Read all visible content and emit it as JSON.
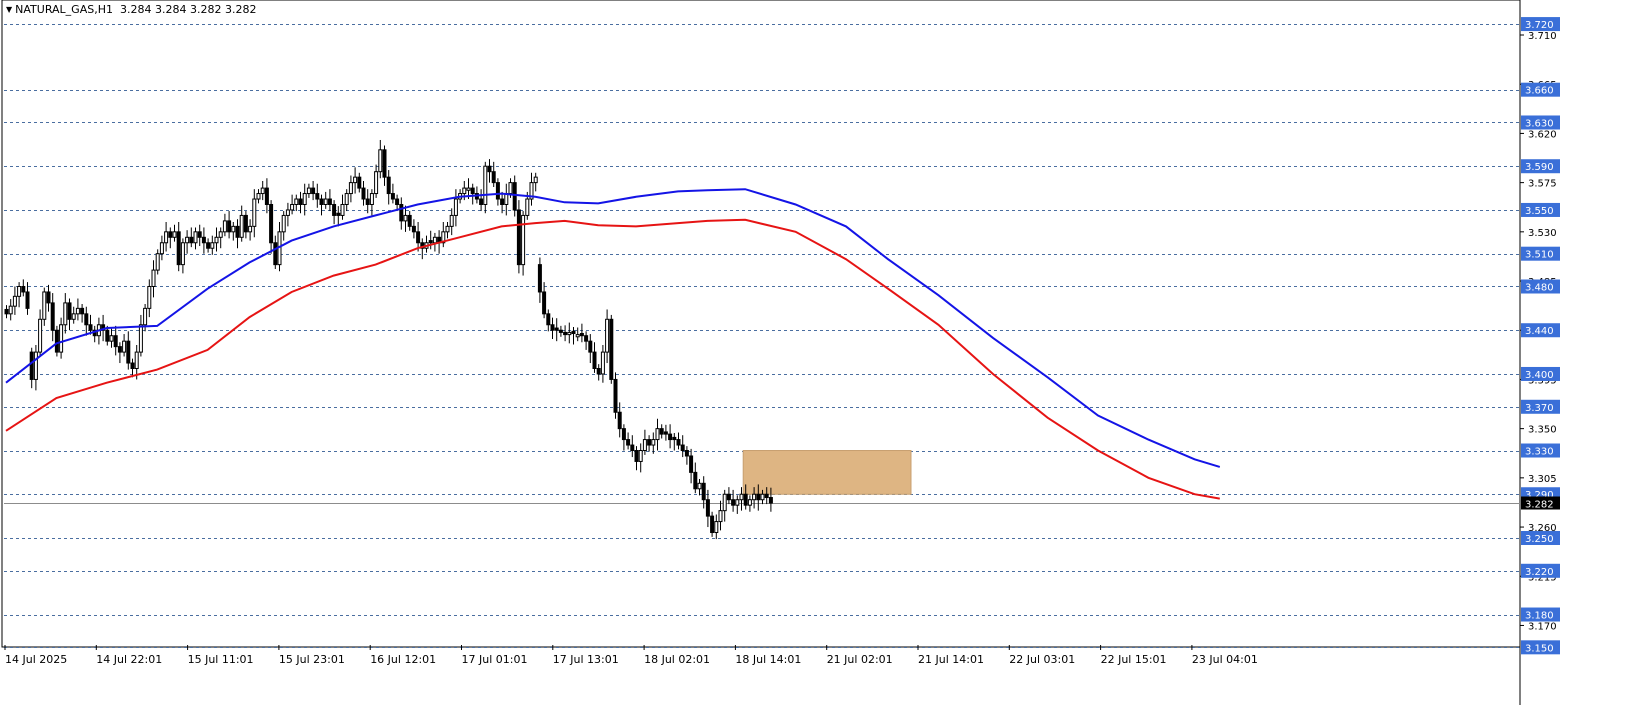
{
  "header": {
    "symbol_label": "NATURAL_GAS,H1",
    "ohlc": "3.284 3.284 3.282 3.282",
    "arrow_icon": "triangle-down-icon"
  },
  "colors": {
    "background": "#ffffff",
    "grid": "#4a6ea0",
    "level_tag_bg": "#3a6fd8",
    "level_tag_text": "#ffffff",
    "price_tag_bg": "#000000",
    "ma_fast": "#1414e6",
    "ma_slow": "#e61414",
    "zone_fill": "#deb583",
    "bull_body": "#ffffff",
    "bear_body": "#000000"
  },
  "chart_data": {
    "type": "candlestick",
    "symbol": "NATURAL_GAS",
    "timeframe": "H1",
    "ylim": [
      3.15,
      3.725
    ],
    "grid": true,
    "axis_ticks": [
      "3.710",
      "3.665",
      "3.620",
      "3.575",
      "3.530",
      "3.485",
      "3.440",
      "3.395",
      "3.350",
      "3.305",
      "3.260",
      "3.215",
      "3.170"
    ],
    "level_tags": [
      "3.720",
      "3.660",
      "3.630",
      "3.590",
      "3.550",
      "3.510",
      "3.480",
      "3.440",
      "3.400",
      "3.370",
      "3.330",
      "3.290",
      "3.250",
      "3.220",
      "3.180",
      "3.150"
    ],
    "current_price": "3.282",
    "time_labels": [
      "14 Jul 2025",
      "14 Jul 22:01",
      "15 Jul 11:01",
      "15 Jul 23:01",
      "16 Jul 12:01",
      "17 Jul 01:01",
      "17 Jul 13:01",
      "18 Jul 02:01",
      "18 Jul 14:01",
      "21 Jul 02:01",
      "21 Jul 14:01",
      "22 Jul 03:01",
      "22 Jul 15:01",
      "23 Jul 04:01"
    ],
    "zone": {
      "price_low": 3.29,
      "price_high": 3.33,
      "bar_start": 176,
      "bar_end": 215
    },
    "closes": [
      3.455,
      3.462,
      3.471,
      3.48,
      3.475,
      3.46,
      3.395,
      3.42,
      3.45,
      3.475,
      3.465,
      3.44,
      3.42,
      3.445,
      3.465,
      3.45,
      3.455,
      3.46,
      3.455,
      3.445,
      3.44,
      3.435,
      3.445,
      3.44,
      3.43,
      3.435,
      3.425,
      3.42,
      3.43,
      3.41,
      3.405,
      3.42,
      3.445,
      3.46,
      3.48,
      3.495,
      3.51,
      3.52,
      3.53,
      3.525,
      3.53,
      3.5,
      3.52,
      3.525,
      3.52,
      3.53,
      3.525,
      3.52,
      3.515,
      3.52,
      3.525,
      3.53,
      3.54,
      3.53,
      3.535,
      3.525,
      3.545,
      3.53,
      3.535,
      3.56,
      3.565,
      3.57,
      3.555,
      3.52,
      3.5,
      3.53,
      3.545,
      3.55,
      3.555,
      3.56,
      3.555,
      3.565,
      3.57,
      3.565,
      3.56,
      3.555,
      3.56,
      3.555,
      3.545,
      3.545,
      3.555,
      3.565,
      3.575,
      3.58,
      3.57,
      3.56,
      3.555,
      3.565,
      3.585,
      3.605,
      3.58,
      3.565,
      3.56,
      3.555,
      3.54,
      3.545,
      3.535,
      3.53,
      3.52,
      3.515,
      3.52,
      3.52,
      3.525,
      3.52,
      3.53,
      3.535,
      3.545,
      3.56,
      3.565,
      3.57,
      3.57,
      3.565,
      3.56,
      3.555,
      3.59,
      3.585,
      3.575,
      3.56,
      3.555,
      3.565,
      3.575,
      3.55,
      3.5,
      3.545,
      3.56,
      3.575,
      3.58,
      3.475,
      3.455,
      3.445,
      3.44,
      3.44,
      3.438,
      3.436,
      3.438,
      3.437,
      3.436,
      3.435,
      3.43,
      3.42,
      3.405,
      3.4,
      3.42,
      3.45,
      3.395,
      3.365,
      3.35,
      3.34,
      3.335,
      3.33,
      3.32,
      3.33,
      3.34,
      3.335,
      3.34,
      3.35,
      3.345,
      3.345,
      3.34,
      3.34,
      3.335,
      3.33,
      3.325,
      3.31,
      3.295,
      3.3,
      3.285,
      3.27,
      3.255,
      3.265,
      3.275,
      3.29,
      3.285,
      3.28,
      3.285,
      3.29,
      3.28,
      3.285,
      3.29,
      3.285,
      3.29,
      3.287,
      3.282
    ],
    "series": [
      {
        "name": "MA fast",
        "color": "#1414e6",
        "points": [
          [
            0,
            3.392
          ],
          [
            12,
            3.428
          ],
          [
            24,
            3.442
          ],
          [
            36,
            3.444
          ],
          [
            48,
            3.478
          ],
          [
            58,
            3.502
          ],
          [
            68,
            3.522
          ],
          [
            78,
            3.535
          ],
          [
            88,
            3.545
          ],
          [
            98,
            3.555
          ],
          [
            108,
            3.562
          ],
          [
            118,
            3.565
          ],
          [
            126,
            3.562
          ],
          [
            133,
            3.557
          ],
          [
            141,
            3.556
          ],
          [
            150,
            3.562
          ],
          [
            160,
            3.567
          ],
          [
            167,
            3.568
          ],
          [
            176,
            3.569
          ],
          [
            188,
            3.555
          ],
          [
            200,
            3.535
          ],
          [
            210,
            3.505
          ],
          [
            222,
            3.472
          ],
          [
            235,
            3.433
          ],
          [
            248,
            3.397
          ],
          [
            260,
            3.362
          ],
          [
            272,
            3.34
          ],
          [
            283,
            3.322
          ],
          [
            289,
            3.315
          ]
        ]
      },
      {
        "name": "MA slow",
        "color": "#e61414",
        "points": [
          [
            0,
            3.348
          ],
          [
            12,
            3.378
          ],
          [
            24,
            3.392
          ],
          [
            36,
            3.404
          ],
          [
            48,
            3.422
          ],
          [
            58,
            3.452
          ],
          [
            68,
            3.475
          ],
          [
            78,
            3.49
          ],
          [
            88,
            3.5
          ],
          [
            98,
            3.515
          ],
          [
            108,
            3.525
          ],
          [
            118,
            3.535
          ],
          [
            126,
            3.538
          ],
          [
            133,
            3.54
          ],
          [
            141,
            3.536
          ],
          [
            150,
            3.535
          ],
          [
            160,
            3.538
          ],
          [
            167,
            3.54
          ],
          [
            176,
            3.541
          ],
          [
            188,
            3.53
          ],
          [
            200,
            3.505
          ],
          [
            210,
            3.478
          ],
          [
            222,
            3.445
          ],
          [
            235,
            3.4
          ],
          [
            248,
            3.36
          ],
          [
            260,
            3.33
          ],
          [
            272,
            3.305
          ],
          [
            283,
            3.29
          ],
          [
            289,
            3.286
          ]
        ]
      }
    ]
  }
}
